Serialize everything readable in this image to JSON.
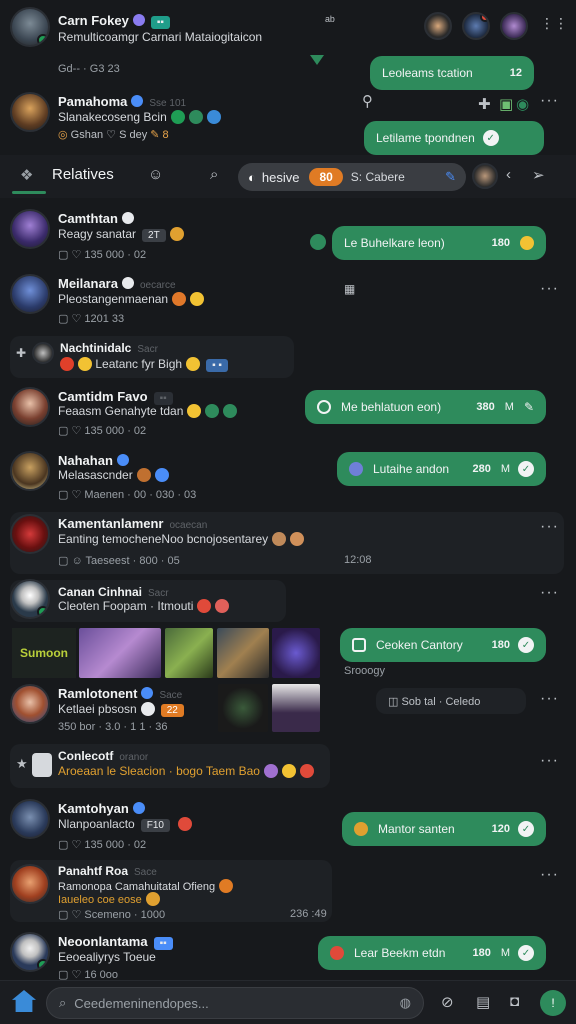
{
  "header": {
    "title": "Carn Fokey",
    "subtitle": "Remulticoamgr Carnari Mataiogitaicon",
    "meta": "Gd-- · G3 23",
    "top_pill": "Leoleams tcation",
    "top_pill_count": "12"
  },
  "row_top": {
    "name": "Pamahoma",
    "faint": "Sse 101",
    "sub": "Slanakecoseng Bcin",
    "meta1": "Gshan",
    "meta2": "S dey",
    "pill": "Letilame tpondnen"
  },
  "tabs": {
    "active": "Relatives",
    "search_label": "hesive",
    "badge": "80",
    "search_suffix": "S: Cabere"
  },
  "contacts": [
    {
      "name": "Camthtan",
      "sub": "Reagy sanatar",
      "chip": "2T",
      "meta": "135 000 · 02",
      "pill": "Le Buhelkare leon)",
      "count": "180"
    },
    {
      "name": "Meilanara",
      "faint": "oecarce",
      "sub": "Pleostangenmaenan",
      "meta": "1201 33"
    },
    {
      "name": "Nachtinidalc",
      "faint": "Sacr",
      "sub": "Leatanc fyr Bigh"
    },
    {
      "name": "Camtidm Favo",
      "sub": "Feaasm Genahyte tdan",
      "meta": "135 000 · 02",
      "pill": "Me behlatuon eon)",
      "count": "380"
    },
    {
      "name": "Nahahan",
      "sub": "Melasascnder",
      "meta": "Maenen · 00 · 030 · 03",
      "pill": "Lutaihe andon",
      "count": "280"
    },
    {
      "name": "Kamentanlamenr",
      "faint": "ocaecan",
      "sub": "Eanting temocheneNoo bcnojosentarey",
      "meta": "Taeseest · 800 · 05",
      "time": "12:08"
    },
    {
      "name": "Canan Cinhnai",
      "faint": "Sacr",
      "sub": "Cleoten  Foopam · Itmouti",
      "banner": "Sumoon",
      "pill": "Ceoken Cantory",
      "count": "180",
      "extra": "Srooogy"
    },
    {
      "name": "Ramlotonent",
      "faint": "Sace",
      "sub": "Ketlaei pbsosn",
      "chip": "22",
      "meta": "350 bor · 3.0 · 1 1 · 36",
      "side": "Sob tal  ·  Celedo"
    },
    {
      "name": "Conlecotf",
      "faint": "oranor",
      "sub": "Aroeaan le Sleacion · bogo Taem Bao"
    },
    {
      "name": "Kamtohyan",
      "sub": "Nlanpoanlacto",
      "chip": "F10",
      "meta": "135 000 · 02",
      "pill": "Mantor santen",
      "count": "120"
    },
    {
      "name": "Panahtf Roa",
      "faint": "Sace",
      "sub": "Ramonopa Camahuitatal Ofieng",
      "sub2": "Iaueleo coe eose",
      "meta": "Scemeno · 1000",
      "time": "236 :49"
    },
    {
      "name": "Neoonlantama",
      "sub": "Eeoealiyrys Toeue",
      "meta": "16 0oo",
      "pill": "Lear Beekm etdn",
      "count": "180"
    }
  ],
  "bottom": {
    "search_placeholder": "Ceedemeninendopes..."
  },
  "colors": {
    "accent": "#2e8b5c",
    "bg": "#17191c",
    "orange": "#e07b24"
  }
}
